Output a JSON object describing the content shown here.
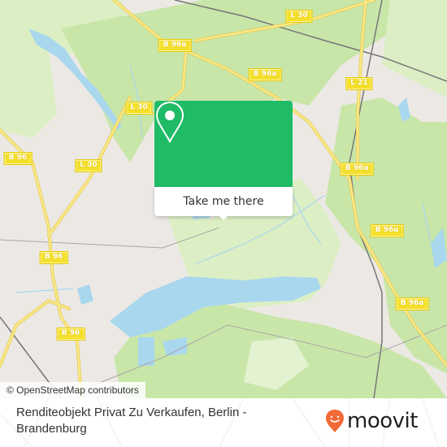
{
  "map": {
    "attribution": "© OpenStreetMap contributors",
    "road_labels": [
      {
        "id": "l30-top",
        "text": "L 30"
      },
      {
        "id": "b96a-1",
        "text": "B 96a"
      },
      {
        "id": "b96a-2",
        "text": "B 96a"
      },
      {
        "id": "l21",
        "text": "L 21"
      },
      {
        "id": "l30-left",
        "text": "L 30"
      },
      {
        "id": "b96-1",
        "text": "B 96"
      },
      {
        "id": "l30-mid",
        "text": "L 30"
      },
      {
        "id": "b96a-3",
        "text": "B 96a"
      },
      {
        "id": "b96a-4",
        "text": "B 96a"
      },
      {
        "id": "b96-2",
        "text": "B 96"
      },
      {
        "id": "b96a-5",
        "text": "B 96a"
      },
      {
        "id": "b96-3",
        "text": "B 96"
      }
    ],
    "colors": {
      "land": "#ece9e5",
      "forest": "#c9e6a9",
      "forest_light": "#dcefc4",
      "water": "#a9d7ee",
      "road": "#f7e36e",
      "rail": "#777777"
    }
  },
  "popup": {
    "button_label": "Take me there",
    "color": "#1fbb67"
  },
  "footer": {
    "place_title": "Renditeobjekt Privat Zu Verkaufen, Berlin - Brandenburg",
    "brand": "moovit",
    "brand_color": "#f26a36"
  }
}
